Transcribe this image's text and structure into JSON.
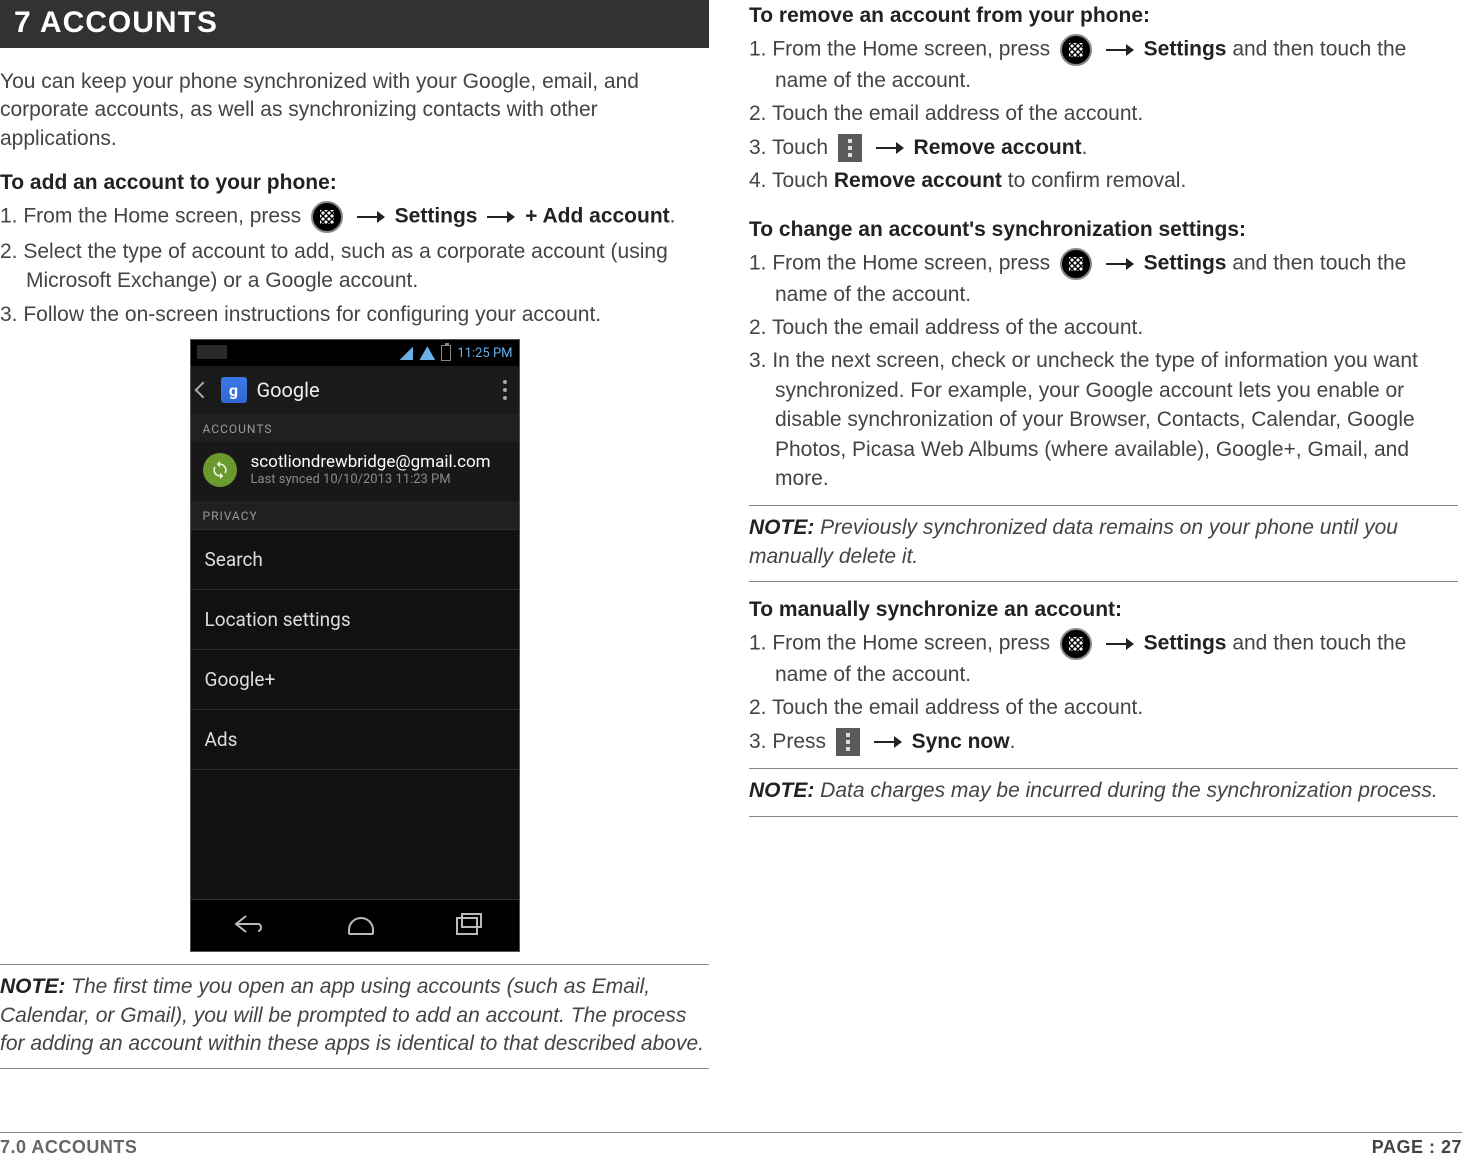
{
  "chapter": {
    "title": "7 ACCOUNTS"
  },
  "intro": "You can keep your phone synchronized with your Google, email, and corporate accounts, as well as synchronizing contacts with other applications.",
  "add": {
    "title": "To add an account to your phone:",
    "step1_a": "1. From the Home screen, press ",
    "step1_b": "Settings",
    "step1_c": "+ Add account",
    "step2": "2. Select the type of account to add, such as a corporate account (using Microsoft Exchange) or a Google account.",
    "step3": "3. Follow the on-screen instructions for configuring your account."
  },
  "phone": {
    "time": "11:25 PM",
    "appbar_title": "Google",
    "section_accounts": "ACCOUNTS",
    "email": "scotliondrewbridge@gmail.com",
    "last_synced": "Last synced 10/10/2013 11:23 PM",
    "section_privacy": "PRIVACY",
    "items": [
      "Search",
      "Location settings",
      "Google+",
      "Ads"
    ]
  },
  "note1": {
    "label": "NOTE:",
    "text": " The first time you open an app using accounts (such as Email, Calendar, or Gmail), you will be prompted to add an account. The process for adding an account within these apps is identical to that described above."
  },
  "remove": {
    "title": "To remove an account from your phone:",
    "step1_a": "1. From the Home screen, press ",
    "step1_b": "Settings",
    "step1_c": " and then touch the name of the account.",
    "step2": "2. Touch the email address of the account.",
    "step3_a": "3. Touch ",
    "step3_b": "Remove account",
    "step4_a": "4. Touch ",
    "step4_b": "Remove account",
    "step4_c": " to confirm removal."
  },
  "change": {
    "title": "To change an account's synchronization settings:",
    "step1_a": "1. From the Home screen, press ",
    "step1_b": "Settings",
    "step1_c": " and then touch the name of the account.",
    "step2": "2. Touch the email address of the account.",
    "step3": "3. In the next screen, check or uncheck the type of information you want synchronized. For example, your Google account lets you enable or disable synchronization of your Browser, Contacts, Calendar, Google Photos, Picasa Web Albums (where available), Google+, Gmail, and more."
  },
  "note2": {
    "label": "NOTE:",
    "text": " Previously synchronized data remains on your phone until you manually delete it."
  },
  "manual": {
    "title": "To manually synchronize an account:",
    "step1_a": "1. From the Home screen, press ",
    "step1_b": "Settings",
    "step1_c": " and then touch the name of the account.",
    "step2": "2. Touch the email address of the account.",
    "step3_a": "3. Press ",
    "step3_b": "Sync now"
  },
  "note3": {
    "label": "NOTE:",
    "text": " Data charges may be incurred during the synchronization process."
  },
  "footer": {
    "left": "7.0 ACCOUNTS",
    "right": "PAGE : 27"
  }
}
